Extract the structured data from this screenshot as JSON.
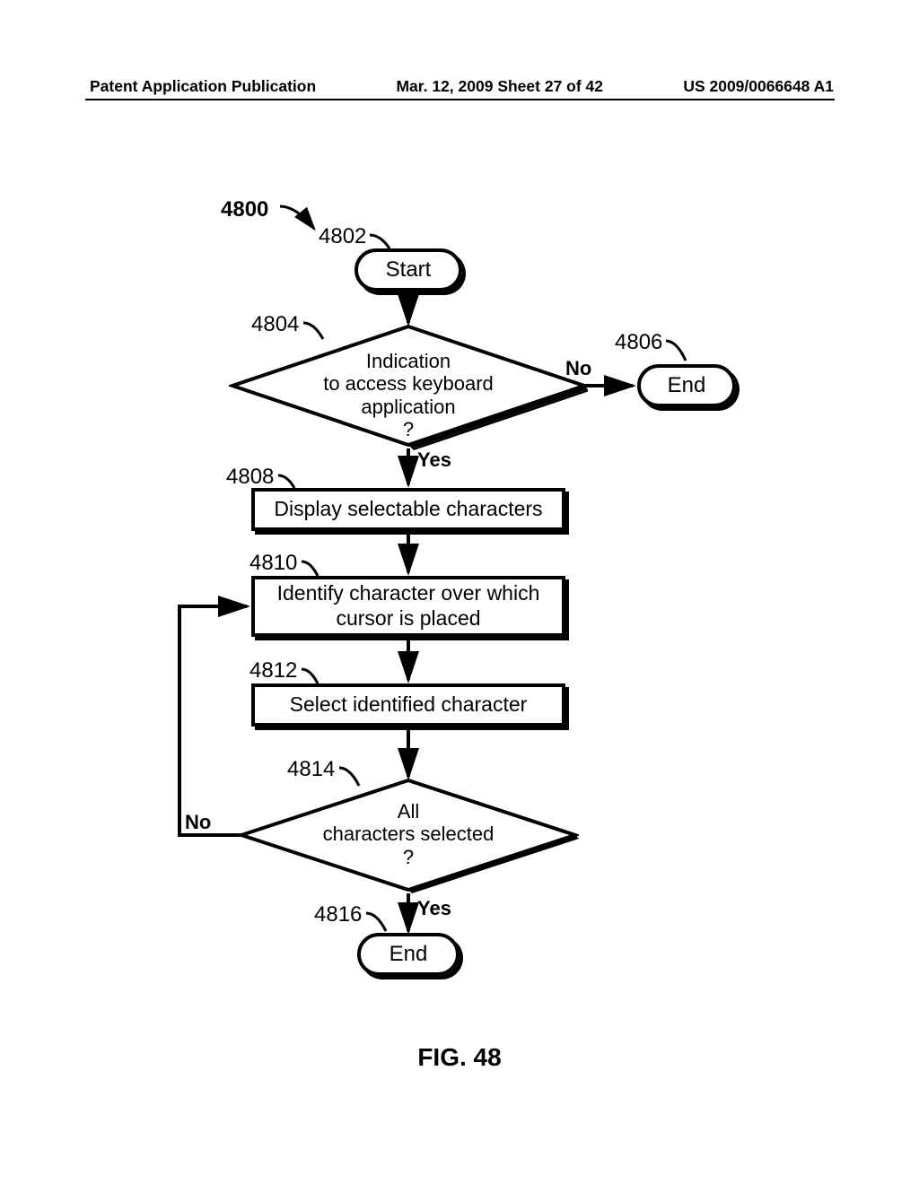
{
  "header": {
    "left": "Patent Application Publication",
    "center": "Mar. 12, 2009  Sheet 27 of 42",
    "right": "US 2009/0066648 A1"
  },
  "flowchart": {
    "ref_main": "4800",
    "nodes": {
      "start": {
        "ref": "4802",
        "text": "Start"
      },
      "dec1": {
        "ref": "4804",
        "text": "Indication\nto access keyboard\napplication\n?"
      },
      "end1": {
        "ref": "4806",
        "text": "End"
      },
      "proc1": {
        "ref": "4808",
        "text": "Display selectable characters"
      },
      "proc2": {
        "ref": "4810",
        "text": "Identify character over which\ncursor is placed"
      },
      "proc3": {
        "ref": "4812",
        "text": "Select identified character"
      },
      "dec2": {
        "ref": "4814",
        "text": "All\ncharacters selected\n?"
      },
      "end2": {
        "ref": "4816",
        "text": "End"
      }
    },
    "edges": {
      "dec1_no": "No",
      "dec1_yes": "Yes",
      "dec2_no": "No",
      "dec2_yes": "Yes"
    }
  },
  "figure_caption": "FIG. 48"
}
